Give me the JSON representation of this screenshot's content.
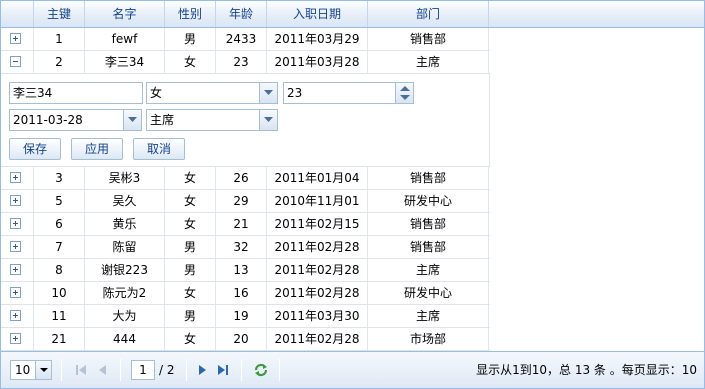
{
  "columns": [
    "主键",
    "名字",
    "性别",
    "年龄",
    "入职日期",
    "部门"
  ],
  "rows_top": [
    {
      "id": "1",
      "name": "fewf",
      "gender": "男",
      "age": "2433",
      "date": "2011年03月29",
      "dept": "销售部",
      "state": "collapsed"
    },
    {
      "id": "2",
      "name": "李三34",
      "gender": "女",
      "age": "23",
      "date": "2011年03月28",
      "dept": "主席",
      "state": "expanded"
    }
  ],
  "editor": {
    "name_value": "李三34",
    "gender_value": "女",
    "age_value": "23",
    "date_value": "2011-03-28",
    "dept_value": "主席",
    "save_label": "保存",
    "apply_label": "应用",
    "cancel_label": "取消"
  },
  "rows_bottom": [
    {
      "id": "3",
      "name": "吴彬3",
      "gender": "女",
      "age": "26",
      "date": "2011年01月04",
      "dept": "销售部"
    },
    {
      "id": "5",
      "name": "吴久",
      "gender": "女",
      "age": "29",
      "date": "2010年11月01",
      "dept": "研发中心"
    },
    {
      "id": "6",
      "name": "黄乐",
      "gender": "女",
      "age": "21",
      "date": "2011年02月15",
      "dept": "销售部"
    },
    {
      "id": "7",
      "name": "陈留",
      "gender": "男",
      "age": "32",
      "date": "2011年02月28",
      "dept": "销售部"
    },
    {
      "id": "8",
      "name": "谢银223",
      "gender": "男",
      "age": "13",
      "date": "2011年02月28",
      "dept": "主席"
    },
    {
      "id": "10",
      "name": "陈元为2",
      "gender": "女",
      "age": "16",
      "date": "2011年02月28",
      "dept": "研发中心"
    },
    {
      "id": "11",
      "name": "大为",
      "gender": "男",
      "age": "19",
      "date": "2011年03月30",
      "dept": "主席"
    },
    {
      "id": "21",
      "name": "444",
      "gender": "女",
      "age": "20",
      "date": "2011年02月28",
      "dept": "市场部"
    }
  ],
  "pager": {
    "page_size": "10",
    "current_page": "1",
    "total_pages": "/ 2",
    "info": "显示从1到10，总 13 条 。每页显示：10"
  }
}
